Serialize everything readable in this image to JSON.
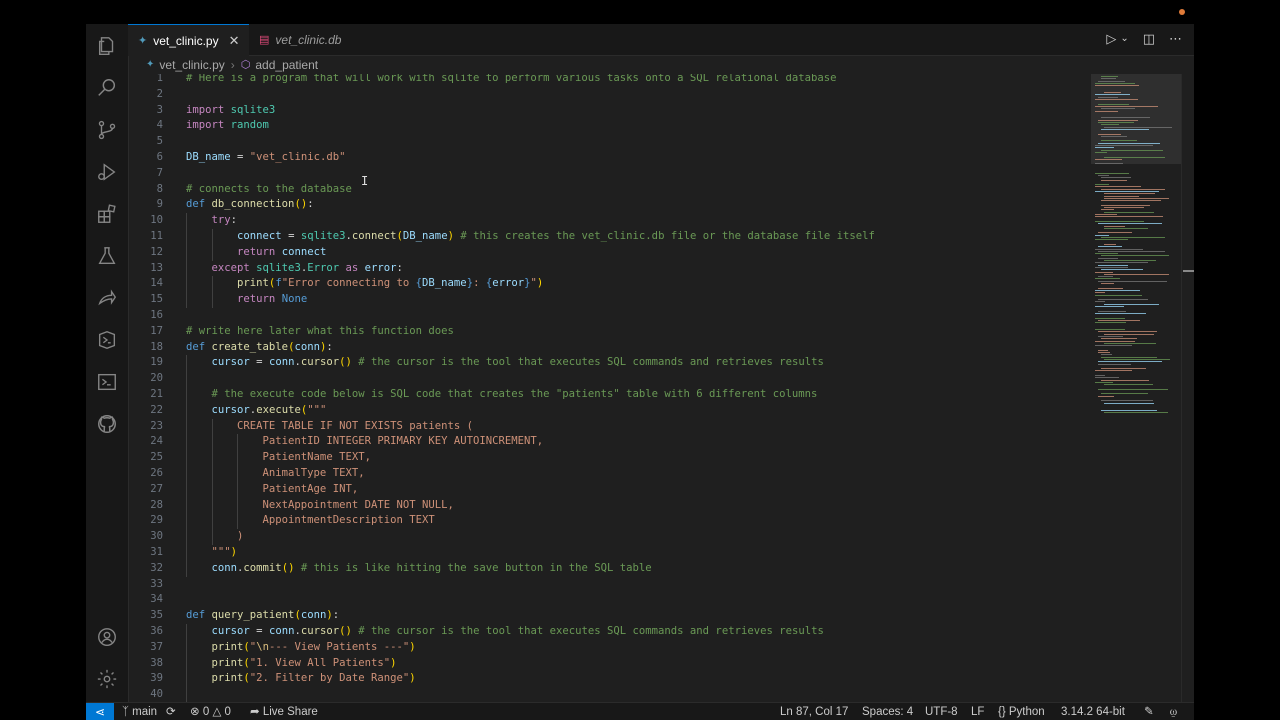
{
  "tabs": [
    {
      "label": "vet_clinic.py",
      "active": true
    },
    {
      "label": "vet_clinic.db",
      "active": false
    }
  ],
  "breadcrumb": {
    "file": "vet_clinic.py",
    "symbol": "add_patient"
  },
  "activity_icons": [
    "explorer-icon",
    "search-icon",
    "source-control-icon",
    "run-debug-icon",
    "extensions-icon",
    "testing-icon",
    "live-share-icon",
    "remote-icon",
    "remote-explorer-icon",
    "github-icon",
    "account-icon",
    "settings-gear-icon"
  ],
  "code_lines": [
    {
      "n": "1",
      "t": [
        [
          "c-cm",
          "# Here is a program that will work with sqlite to perform various tasks onto a SQL relational database"
        ]
      ]
    },
    {
      "n": "2",
      "t": []
    },
    {
      "n": "3",
      "t": [
        [
          "c-kw",
          "import "
        ],
        [
          "c-cls",
          "sqlite3"
        ]
      ]
    },
    {
      "n": "4",
      "t": [
        [
          "c-kw",
          "import "
        ],
        [
          "c-cls",
          "random"
        ]
      ]
    },
    {
      "n": "5",
      "t": []
    },
    {
      "n": "6",
      "t": [
        [
          "c-var",
          "DB_name"
        ],
        [
          "c-op",
          " = "
        ],
        [
          "c-str",
          "\"vet_clinic.db\""
        ]
      ]
    },
    {
      "n": "7",
      "t": []
    },
    {
      "n": "8",
      "t": [
        [
          "c-cm",
          "# connects to the database"
        ]
      ]
    },
    {
      "n": "9",
      "t": [
        [
          "c-kwb",
          "def "
        ],
        [
          "c-fn",
          "db_connection"
        ],
        [
          "c-br",
          "()"
        ],
        [
          "c-op",
          ":"
        ]
      ]
    },
    {
      "n": "10",
      "t": [
        [
          "c-op",
          "    "
        ],
        [
          "c-kw",
          "try"
        ],
        [
          "c-op",
          ":"
        ]
      ]
    },
    {
      "n": "11",
      "t": [
        [
          "c-op",
          "        "
        ],
        [
          "c-var",
          "connect"
        ],
        [
          "c-op",
          " = "
        ],
        [
          "c-cls",
          "sqlite3"
        ],
        [
          "c-op",
          "."
        ],
        [
          "c-fn",
          "connect"
        ],
        [
          "c-br",
          "("
        ],
        [
          "c-var",
          "DB_name"
        ],
        [
          "c-br",
          ")"
        ],
        [
          "c-cm",
          " # this creates the vet_clinic.db file or the database file itself"
        ]
      ]
    },
    {
      "n": "12",
      "t": [
        [
          "c-op",
          "        "
        ],
        [
          "c-kw",
          "return "
        ],
        [
          "c-var",
          "connect"
        ]
      ]
    },
    {
      "n": "13",
      "t": [
        [
          "c-op",
          "    "
        ],
        [
          "c-kw",
          "except "
        ],
        [
          "c-cls",
          "sqlite3"
        ],
        [
          "c-op",
          "."
        ],
        [
          "c-cls",
          "Error "
        ],
        [
          "c-kw",
          "as "
        ],
        [
          "c-var",
          "error"
        ],
        [
          "c-op",
          ":"
        ]
      ]
    },
    {
      "n": "14",
      "t": [
        [
          "c-op",
          "        "
        ],
        [
          "c-fn",
          "print"
        ],
        [
          "c-br",
          "("
        ],
        [
          "c-kwb",
          "f"
        ],
        [
          "c-str",
          "\"Error connecting to "
        ],
        [
          "c-kwb",
          "{"
        ],
        [
          "c-var",
          "DB_name"
        ],
        [
          "c-kwb",
          "}"
        ],
        [
          "c-str",
          ": "
        ],
        [
          "c-kwb",
          "{"
        ],
        [
          "c-var",
          "error"
        ],
        [
          "c-kwb",
          "}"
        ],
        [
          "c-str",
          "\""
        ],
        [
          "c-br",
          ")"
        ]
      ]
    },
    {
      "n": "15",
      "t": [
        [
          "c-op",
          "        "
        ],
        [
          "c-kw",
          "return "
        ],
        [
          "c-kwb",
          "None"
        ]
      ]
    },
    {
      "n": "16",
      "t": []
    },
    {
      "n": "17",
      "t": [
        [
          "c-cm",
          "# write here later what this function does"
        ]
      ]
    },
    {
      "n": "18",
      "t": [
        [
          "c-kwb",
          "def "
        ],
        [
          "c-fn",
          "create_table"
        ],
        [
          "c-br",
          "("
        ],
        [
          "c-var",
          "conn"
        ],
        [
          "c-br",
          ")"
        ],
        [
          "c-op",
          ":"
        ]
      ]
    },
    {
      "n": "19",
      "t": [
        [
          "c-op",
          "    "
        ],
        [
          "c-var",
          "cursor"
        ],
        [
          "c-op",
          " = "
        ],
        [
          "c-var",
          "conn"
        ],
        [
          "c-op",
          "."
        ],
        [
          "c-fn",
          "cursor"
        ],
        [
          "c-br",
          "()"
        ],
        [
          "c-cm",
          " # the cursor is the tool that executes SQL commands and retrieves results"
        ]
      ]
    },
    {
      "n": "20",
      "t": []
    },
    {
      "n": "21",
      "t": [
        [
          "c-op",
          "    "
        ],
        [
          "c-cm",
          "# the execute code below is SQL code that creates the \"patients\" table with 6 different columns"
        ]
      ]
    },
    {
      "n": "22",
      "t": [
        [
          "c-op",
          "    "
        ],
        [
          "c-var",
          "cursor"
        ],
        [
          "c-op",
          "."
        ],
        [
          "c-fn",
          "execute"
        ],
        [
          "c-br",
          "("
        ],
        [
          "c-str",
          "\"\"\""
        ]
      ]
    },
    {
      "n": "23",
      "t": [
        [
          "c-str",
          "        CREATE TABLE IF NOT EXISTS patients ("
        ]
      ]
    },
    {
      "n": "24",
      "t": [
        [
          "c-str",
          "            PatientID INTEGER PRIMARY KEY AUTOINCREMENT,"
        ]
      ]
    },
    {
      "n": "25",
      "t": [
        [
          "c-str",
          "            PatientName TEXT,"
        ]
      ]
    },
    {
      "n": "26",
      "t": [
        [
          "c-str",
          "            AnimalType TEXT,"
        ]
      ]
    },
    {
      "n": "27",
      "t": [
        [
          "c-str",
          "            PatientAge INT,"
        ]
      ]
    },
    {
      "n": "28",
      "t": [
        [
          "c-str",
          "            NextAppointment DATE NOT NULL,"
        ]
      ]
    },
    {
      "n": "29",
      "t": [
        [
          "c-str",
          "            AppointmentDescription TEXT"
        ]
      ]
    },
    {
      "n": "30",
      "t": [
        [
          "c-str",
          "        )"
        ]
      ]
    },
    {
      "n": "31",
      "t": [
        [
          "c-str",
          "    \"\"\""
        ],
        [
          "c-br",
          ")"
        ]
      ]
    },
    {
      "n": "32",
      "t": [
        [
          "c-op",
          "    "
        ],
        [
          "c-var",
          "conn"
        ],
        [
          "c-op",
          "."
        ],
        [
          "c-fn",
          "commit"
        ],
        [
          "c-br",
          "()"
        ],
        [
          "c-cm",
          " # this is like hitting the save button in the SQL table"
        ]
      ]
    },
    {
      "n": "33",
      "t": []
    },
    {
      "n": "34",
      "t": []
    },
    {
      "n": "35",
      "t": [
        [
          "c-kwb",
          "def "
        ],
        [
          "c-fn",
          "query_patient"
        ],
        [
          "c-br",
          "("
        ],
        [
          "c-var",
          "conn"
        ],
        [
          "c-br",
          ")"
        ],
        [
          "c-op",
          ":"
        ]
      ]
    },
    {
      "n": "36",
      "t": [
        [
          "c-op",
          "    "
        ],
        [
          "c-var",
          "cursor"
        ],
        [
          "c-op",
          " = "
        ],
        [
          "c-var",
          "conn"
        ],
        [
          "c-op",
          "."
        ],
        [
          "c-fn",
          "cursor"
        ],
        [
          "c-br",
          "()"
        ],
        [
          "c-cm",
          " # the cursor is the tool that executes SQL commands and retrieves results"
        ]
      ]
    },
    {
      "n": "37",
      "t": [
        [
          "c-op",
          "    "
        ],
        [
          "c-fn",
          "print"
        ],
        [
          "c-br",
          "("
        ],
        [
          "c-str",
          "\""
        ],
        [
          "c-esc",
          "\\n"
        ],
        [
          "c-str",
          "--- View Patients ---\""
        ],
        [
          "c-br",
          ")"
        ]
      ]
    },
    {
      "n": "38",
      "t": [
        [
          "c-op",
          "    "
        ],
        [
          "c-fn",
          "print"
        ],
        [
          "c-br",
          "("
        ],
        [
          "c-str",
          "\"1. View All Patients\""
        ],
        [
          "c-br",
          ")"
        ]
      ]
    },
    {
      "n": "39",
      "t": [
        [
          "c-op",
          "    "
        ],
        [
          "c-fn",
          "print"
        ],
        [
          "c-br",
          "("
        ],
        [
          "c-str",
          "\"2. Filter by Date Range\""
        ],
        [
          "c-br",
          ")"
        ]
      ]
    },
    {
      "n": "40",
      "t": []
    }
  ],
  "status": {
    "branch": "main",
    "errors": "0",
    "warnings": "0",
    "live_share": "Live Share",
    "position": "Ln 87, Col 17",
    "spaces": "Spaces: 4",
    "encoding": "UTF-8",
    "eol": "LF",
    "language": "Python",
    "interpreter": "3.14.2 64-bit"
  },
  "colors": {
    "accent": "#0078d4",
    "editor_bg": "#1f1f1f",
    "sidebar_bg": "#181818"
  }
}
